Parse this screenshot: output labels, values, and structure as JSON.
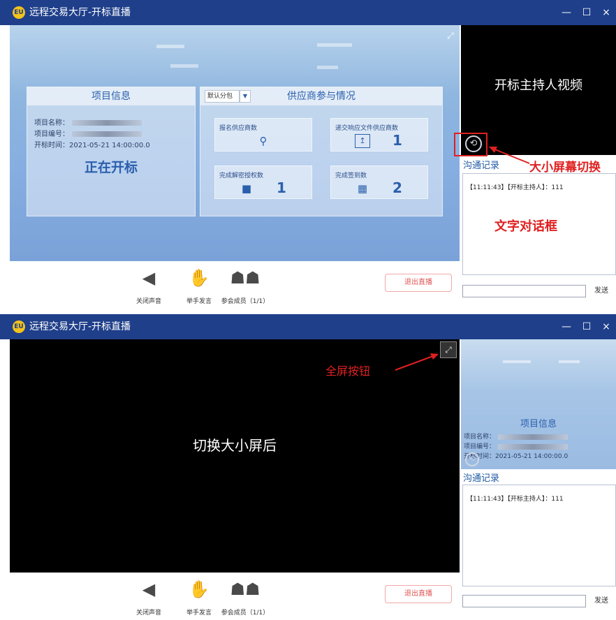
{
  "window": {
    "title": "远程交易大厅-开标直播",
    "app_icon": "EU",
    "minimize_glyph": "—",
    "maximize_glyph": "☐",
    "close_glyph": "×"
  },
  "project_info": {
    "heading": "项目信息",
    "name_label": "项目名称：",
    "number_label": "项目编号：",
    "time_label": "开标时间：",
    "time_value": "2021-05-21 14:00:00.0",
    "status": "正在开标"
  },
  "supplier": {
    "heading": "供应商参与情况",
    "package_select": "默认分包",
    "cards": [
      {
        "label": "报名供应商数",
        "icon": "user-search-icon",
        "value": ""
      },
      {
        "label": "递交响应文件供应商数",
        "icon": "upload-icon",
        "value": "1"
      },
      {
        "label": "完成解密授权数",
        "icon": "lock-folder-icon",
        "value": "1"
      },
      {
        "label": "完成签到数",
        "icon": "calendar-check-icon",
        "value": "2"
      }
    ]
  },
  "toolbar": {
    "mute_label": "关闭声音",
    "raise_hand_label": "举手发言",
    "members_label": "参会成员（1/1）",
    "exit_label": "退出直播"
  },
  "side": {
    "host_video_label": "开标主持人视频",
    "chat_title": "沟通记录",
    "chat_message": "【11:11:43】【开标主持人】：111",
    "send_label": "发送"
  },
  "annotations": {
    "switch_label": "大小屏幕切换",
    "chat_box_label": "文字对话框",
    "fullscreen_label": "全屏按钮",
    "after_switch_label": "切换大小屏后"
  },
  "colors": {
    "titlebar": "#1f3f8a",
    "accent": "#2b5fad",
    "annotation_red": "#e02020"
  }
}
